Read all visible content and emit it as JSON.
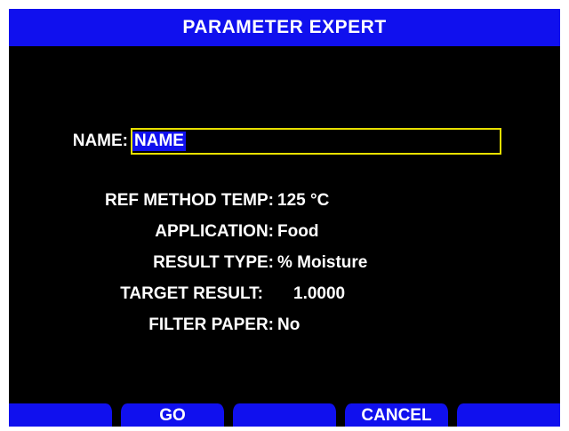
{
  "header": {
    "title": "PARAMETER EXPERT"
  },
  "name_field": {
    "label": "NAME:",
    "value": "NAME"
  },
  "fields": [
    {
      "label": "REF METHOD TEMP:",
      "value": "125 °C"
    },
    {
      "label": "APPLICATION:",
      "value": "Food"
    },
    {
      "label": "RESULT TYPE:",
      "value": "% Moisture"
    },
    {
      "label": "TARGET RESULT:",
      "value": "1.0000"
    },
    {
      "label": "FILTER PAPER:",
      "value": "No"
    }
  ],
  "softkeys": [
    "",
    "GO",
    "",
    "CANCEL",
    ""
  ],
  "colors": {
    "title_bar": "#1010ee",
    "screen": "#000000",
    "focus_border": "#e8e000",
    "text": "#ffffff"
  }
}
